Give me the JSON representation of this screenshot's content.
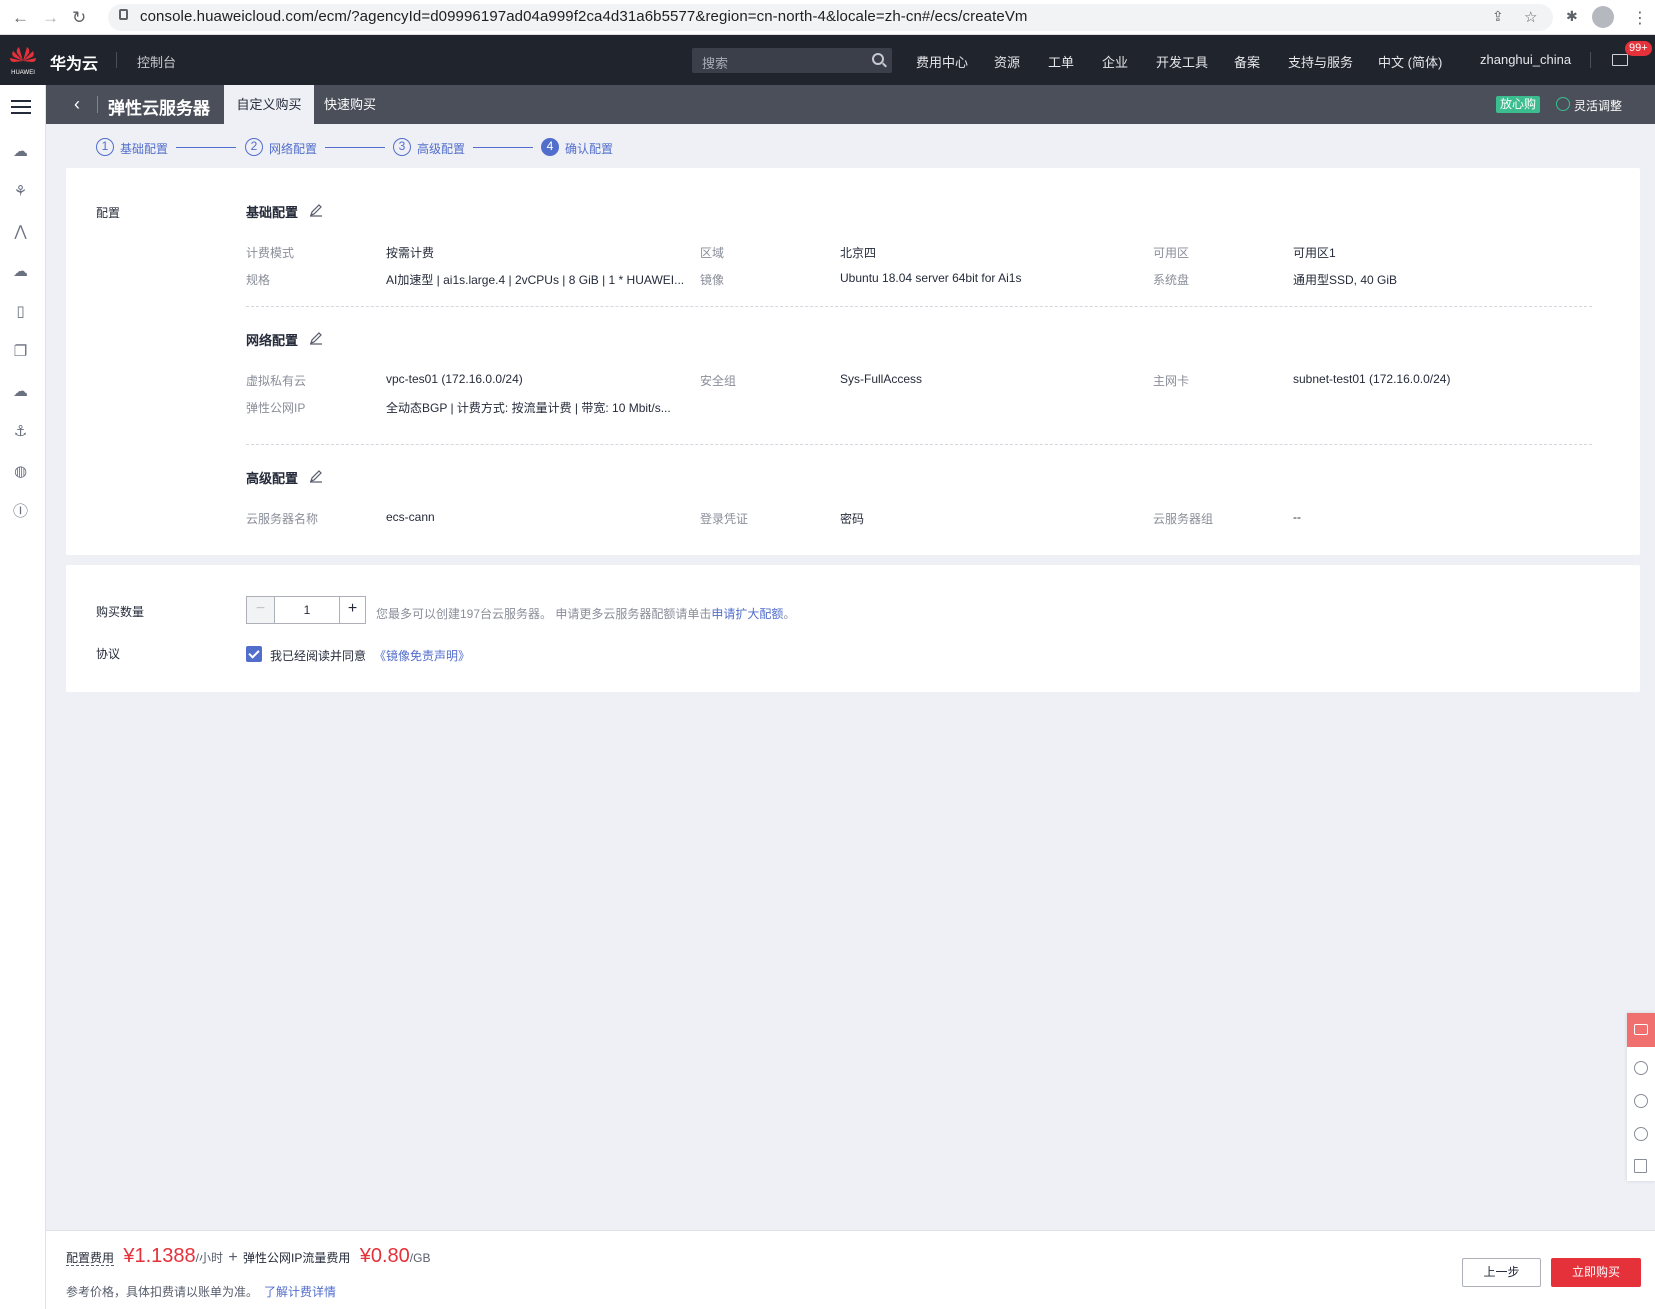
{
  "browser": {
    "url": "console.huaweicloud.com/ecm/?agencyId=d09996197ad04a999f2ca4d31a6b5577&region=cn-north-4&locale=zh-cn#/ecs/createVm"
  },
  "header": {
    "logo_text": "HUAWEI",
    "brand": "华为云",
    "console": "控制台",
    "search_placeholder": "搜索",
    "nav": [
      "费用中心",
      "资源",
      "工单",
      "企业",
      "开发工具",
      "备案",
      "支持与服务",
      "中文 (简体)",
      "zhanghui_china"
    ],
    "badge": "99+"
  },
  "subheader": {
    "title": "弹性云服务器",
    "tabs": [
      "自定义购买",
      "快速购买"
    ],
    "tag": "放心购",
    "flex_adjust": "灵活调整"
  },
  "steps": [
    {
      "num": "1",
      "label": "基础配置"
    },
    {
      "num": "2",
      "label": "网络配置"
    },
    {
      "num": "3",
      "label": "高级配置"
    },
    {
      "num": "4",
      "label": "确认配置"
    }
  ],
  "config": {
    "label": "配置",
    "basic": {
      "title": "基础配置",
      "rows": [
        [
          {
            "k": "计费模式",
            "v": "按需计费"
          },
          {
            "k": "区域",
            "v": "北京四"
          },
          {
            "k": "可用区",
            "v": "可用区1"
          }
        ],
        [
          {
            "k": "规格",
            "v": "AI加速型 | ai1s.large.4 | 2vCPUs | 8 GiB | 1 * HUAWEI..."
          },
          {
            "k": "镜像",
            "v": "Ubuntu 18.04 server 64bit for Ai1s"
          },
          {
            "k": "系统盘",
            "v": "通用型SSD, 40 GiB"
          }
        ]
      ]
    },
    "network": {
      "title": "网络配置",
      "rows": [
        [
          {
            "k": "虚拟私有云",
            "v": "vpc-tes01 (172.16.0.0/24)"
          },
          {
            "k": "安全组",
            "v": "Sys-FullAccess"
          },
          {
            "k": "主网卡",
            "v": "subnet-test01 (172.16.0.0/24)"
          }
        ],
        [
          {
            "k": "弹性公网IP",
            "v": "全动态BGP | 计费方式: 按流量计费 | 带宽: 10 Mbit/s..."
          }
        ]
      ]
    },
    "advanced": {
      "title": "高级配置",
      "rows": [
        [
          {
            "k": "云服务器名称",
            "v": "ecs-cann"
          },
          {
            "k": "登录凭证",
            "v": "密码"
          },
          {
            "k": "云服务器组",
            "v": "--"
          }
        ]
      ]
    }
  },
  "purchase": {
    "qty_label": "购买数量",
    "qty_value": "1",
    "minus": "−",
    "plus": "+",
    "hint": "您最多可以创建197台云服务器。 申请更多云服务器配额请单击",
    "hint_link": "申请扩大配额",
    "hint_end": "。",
    "agreement_label": "协议",
    "agree_text": "我已经阅读并同意",
    "agree_link": "《镜像免责声明》",
    "agreed": true
  },
  "footer": {
    "config_fee_label": "配置费用",
    "config_fee": "¥1.1388",
    "config_fee_unit": "/小时",
    "plus": "+",
    "eip_fee_label": "弹性公网IP流量费用",
    "eip_fee": "¥0.80",
    "eip_fee_unit": "/GB",
    "note": "参考价格，具体扣费请以账单为准。",
    "note_link": "了解计费详情",
    "prev": "上一步",
    "buy": "立即购买"
  },
  "colors": {
    "accent": "#526ecc",
    "price": "#e5313a",
    "topbar": "#20242c",
    "subbar": "#4b4f5a",
    "green": "#3bbd8f"
  }
}
